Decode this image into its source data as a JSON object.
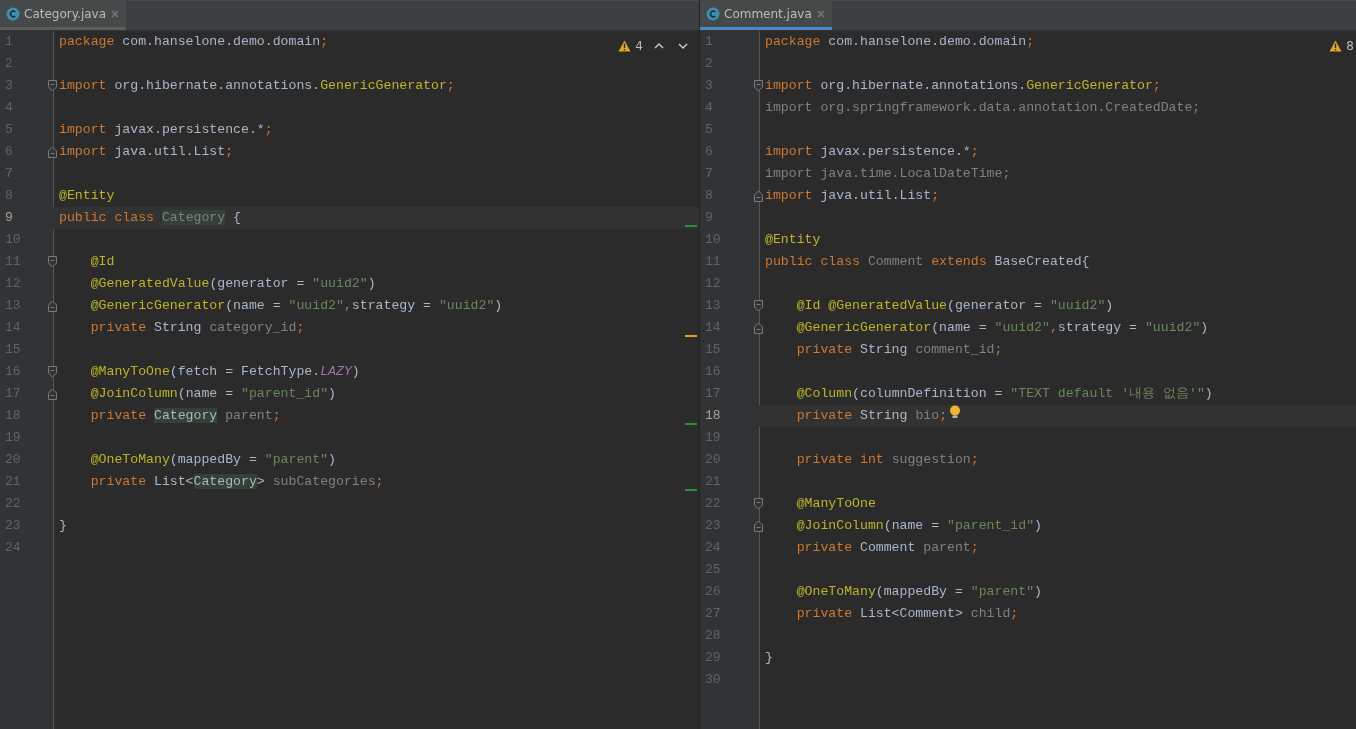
{
  "editors": [
    {
      "focused": false,
      "tab": {
        "label": "Category.java",
        "selected": true
      },
      "inspections": {
        "warnings": "4",
        "nav_arrows": true
      },
      "lines": [
        {
          "number": "1",
          "current": false,
          "tokens": [
            {
              "kind": "keyword",
              "text": "package "
            },
            {
              "kind": "plain",
              "text": "com.hanselone.demo.domain"
            },
            {
              "kind": "keyword",
              "text": ";"
            }
          ]
        },
        {
          "number": "2",
          "current": false
        },
        {
          "number": "3",
          "current": false,
          "fold": {
            "kind": "start"
          },
          "tokens": [
            {
              "kind": "keyword",
              "text": "import "
            },
            {
              "kind": "plain",
              "text": "org.hibernate.annotations."
            },
            {
              "kind": "annotation",
              "text": "GenericGenerator"
            },
            {
              "kind": "keyword",
              "text": ";"
            }
          ]
        },
        {
          "number": "4",
          "current": false
        },
        {
          "number": "5",
          "current": false,
          "tokens": [
            {
              "kind": "keyword",
              "text": "import "
            },
            {
              "kind": "plain",
              "text": "javax.persistence.*"
            },
            {
              "kind": "keyword",
              "text": ";"
            }
          ]
        },
        {
          "number": "6",
          "current": false,
          "fold": {
            "kind": "end"
          },
          "tokens": [
            {
              "kind": "keyword",
              "text": "import "
            },
            {
              "kind": "plain",
              "text": "java.util.List"
            },
            {
              "kind": "keyword",
              "text": ";"
            }
          ]
        },
        {
          "number": "7",
          "current": false
        },
        {
          "number": "8",
          "current": false,
          "tokens": [
            {
              "kind": "annotation",
              "text": "@Entity"
            }
          ]
        },
        {
          "number": "9",
          "current": true,
          "tokens": [
            {
              "kind": "keyword",
              "text": "public class "
            },
            {
              "kind": "declaration",
              "text": "Category"
            },
            {
              "kind": "plain",
              "text": " {"
            }
          ]
        },
        {
          "number": "10",
          "current": false,
          "stripe": {
            "color": "#2f8a3a"
          }
        },
        {
          "number": "11",
          "current": false,
          "fold": {
            "kind": "start"
          },
          "tokens": [
            {
              "kind": "annotation",
              "text": "    @Id"
            }
          ]
        },
        {
          "number": "12",
          "current": false,
          "tokens": [
            {
              "kind": "annotation",
              "text": "    @GeneratedValue"
            },
            {
              "kind": "plain",
              "text": "(generator = "
            },
            {
              "kind": "string",
              "text": "\"uuid2\""
            },
            {
              "kind": "plain",
              "text": ")"
            }
          ]
        },
        {
          "number": "13",
          "current": false,
          "fold": {
            "kind": "end"
          },
          "tokens": [
            {
              "kind": "annotation",
              "text": "    @GenericGenerator"
            },
            {
              "kind": "plain",
              "text": "(name = "
            },
            {
              "kind": "string",
              "text": "\"uuid2\""
            },
            {
              "kind": "keyword",
              "text": ","
            },
            {
              "kind": "plain",
              "text": "strategy = "
            },
            {
              "kind": "string",
              "text": "\"uuid2\""
            },
            {
              "kind": "plain",
              "text": ")"
            }
          ]
        },
        {
          "number": "14",
          "current": false,
          "tokens": [
            {
              "kind": "keyword",
              "text": "    private "
            },
            {
              "kind": "plain",
              "text": "String "
            },
            {
              "kind": "unused",
              "text": "category_id"
            },
            {
              "kind": "keyword",
              "text": ";"
            }
          ]
        },
        {
          "number": "15",
          "current": false,
          "stripe": {
            "color": "#d9a31c"
          }
        },
        {
          "number": "16",
          "current": false,
          "fold": {
            "kind": "start"
          },
          "tokens": [
            {
              "kind": "annotation",
              "text": "    @ManyToOne"
            },
            {
              "kind": "plain",
              "text": "(fetch = FetchType."
            },
            {
              "kind": "constant",
              "text": "LAZY"
            },
            {
              "kind": "plain",
              "text": ")"
            }
          ]
        },
        {
          "number": "17",
          "current": false,
          "fold": {
            "kind": "end"
          },
          "tokens": [
            {
              "kind": "annotation",
              "text": "    @JoinColumn"
            },
            {
              "kind": "plain",
              "text": "(name = "
            },
            {
              "kind": "string",
              "text": "\"parent_id\""
            },
            {
              "kind": "plain",
              "text": ")"
            }
          ]
        },
        {
          "number": "18",
          "current": false,
          "tokens": [
            {
              "kind": "keyword",
              "text": "    private "
            },
            {
              "kind": "usage",
              "text": "Category"
            },
            {
              "kind": "unused",
              "text": " parent"
            },
            {
              "kind": "keyword",
              "text": ";"
            }
          ]
        },
        {
          "number": "19",
          "current": false,
          "stripe": {
            "color": "#2f8a3a"
          }
        },
        {
          "number": "20",
          "current": false,
          "tokens": [
            {
              "kind": "annotation",
              "text": "    @OneToMany"
            },
            {
              "kind": "plain",
              "text": "(mappedBy = "
            },
            {
              "kind": "string",
              "text": "\"parent\""
            },
            {
              "kind": "plain",
              "text": ")"
            }
          ]
        },
        {
          "number": "21",
          "current": false,
          "tokens": [
            {
              "kind": "keyword",
              "text": "    private "
            },
            {
              "kind": "plain",
              "text": "List<"
            },
            {
              "kind": "usage",
              "text": "Category"
            },
            {
              "kind": "plain",
              "text": "> "
            },
            {
              "kind": "unused",
              "text": "subCategories"
            },
            {
              "kind": "keyword",
              "text": ";"
            }
          ]
        },
        {
          "number": "22",
          "current": false,
          "stripe": {
            "color": "#2f8a3a"
          }
        },
        {
          "number": "23",
          "current": false,
          "tokens": [
            {
              "kind": "plain",
              "text": "}"
            }
          ]
        },
        {
          "number": "24",
          "current": false
        }
      ]
    },
    {
      "focused": true,
      "tab": {
        "label": "Comment.java",
        "selected": true
      },
      "inspections": {
        "warnings": "8",
        "nav_arrows": false
      },
      "lines": [
        {
          "number": "1",
          "current": false,
          "tokens": [
            {
              "kind": "keyword",
              "text": "package "
            },
            {
              "kind": "plain",
              "text": "com.hanselone.demo.domain"
            },
            {
              "kind": "keyword",
              "text": ";"
            }
          ]
        },
        {
          "number": "2",
          "current": false
        },
        {
          "number": "3",
          "current": false,
          "fold": {
            "kind": "start"
          },
          "tokens": [
            {
              "kind": "keyword",
              "text": "import "
            },
            {
              "kind": "plain",
              "text": "org.hibernate.annotations."
            },
            {
              "kind": "annotation",
              "text": "GenericGenerator"
            },
            {
              "kind": "keyword",
              "text": ";"
            }
          ]
        },
        {
          "number": "4",
          "current": false,
          "tokens": [
            {
              "kind": "unused",
              "text": "import org.springframework.data.annotation.CreatedDate;"
            }
          ]
        },
        {
          "number": "5",
          "current": false
        },
        {
          "number": "6",
          "current": false,
          "tokens": [
            {
              "kind": "keyword",
              "text": "import "
            },
            {
              "kind": "plain",
              "text": "javax.persistence.*"
            },
            {
              "kind": "keyword",
              "text": ";"
            }
          ]
        },
        {
          "number": "7",
          "current": false,
          "tokens": [
            {
              "kind": "unused",
              "text": "import java.time.LocalDateTime;"
            }
          ]
        },
        {
          "number": "8",
          "current": false,
          "fold": {
            "kind": "end"
          },
          "tokens": [
            {
              "kind": "keyword",
              "text": "import "
            },
            {
              "kind": "plain",
              "text": "java.util.List"
            },
            {
              "kind": "keyword",
              "text": ";"
            }
          ]
        },
        {
          "number": "9",
          "current": false
        },
        {
          "number": "10",
          "current": false,
          "tokens": [
            {
              "kind": "annotation",
              "text": "@Entity"
            }
          ]
        },
        {
          "number": "11",
          "current": false,
          "tokens": [
            {
              "kind": "keyword",
              "text": "public class "
            },
            {
              "kind": "unused",
              "text": "Comment"
            },
            {
              "kind": "keyword",
              "text": " extends "
            },
            {
              "kind": "plain",
              "text": "BaseCreated{"
            }
          ]
        },
        {
          "number": "12",
          "current": false
        },
        {
          "number": "13",
          "current": false,
          "fold": {
            "kind": "start"
          },
          "tokens": [
            {
              "kind": "annotation",
              "text": "    @Id @GeneratedValue"
            },
            {
              "kind": "plain",
              "text": "(generator = "
            },
            {
              "kind": "string",
              "text": "\"uuid2\""
            },
            {
              "kind": "plain",
              "text": ")"
            }
          ]
        },
        {
          "number": "14",
          "current": false,
          "fold": {
            "kind": "end"
          },
          "tokens": [
            {
              "kind": "annotation",
              "text": "    @GenericGenerator"
            },
            {
              "kind": "plain",
              "text": "(name = "
            },
            {
              "kind": "string",
              "text": "\"uuid2\""
            },
            {
              "kind": "keyword",
              "text": ","
            },
            {
              "kind": "plain",
              "text": "strategy = "
            },
            {
              "kind": "string",
              "text": "\"uuid2\""
            },
            {
              "kind": "plain",
              "text": ")"
            }
          ]
        },
        {
          "number": "15",
          "current": false,
          "tokens": [
            {
              "kind": "keyword",
              "text": "    private "
            },
            {
              "kind": "plain",
              "text": "String "
            },
            {
              "kind": "unused",
              "text": "comment_id"
            },
            {
              "kind": "keyword",
              "text": ";"
            }
          ]
        },
        {
          "number": "16",
          "current": false
        },
        {
          "number": "17",
          "current": false,
          "tokens": [
            {
              "kind": "annotation",
              "text": "    @Column"
            },
            {
              "kind": "plain",
              "text": "(columnDefinition = "
            },
            {
              "kind": "string",
              "text": "\"TEXT default '내용 없음'\""
            },
            {
              "kind": "plain",
              "text": ")"
            }
          ]
        },
        {
          "number": "18",
          "current": true,
          "tokens": [
            {
              "kind": "keyword",
              "text": "    private "
            },
            {
              "kind": "plain",
              "text": "String "
            },
            {
              "kind": "unused",
              "text": "bio"
            },
            {
              "kind": "keyword",
              "text": ";"
            },
            {
              "kind": "bulb"
            }
          ]
        },
        {
          "number": "19",
          "current": false
        },
        {
          "number": "20",
          "current": false,
          "tokens": [
            {
              "kind": "keyword",
              "text": "    private int "
            },
            {
              "kind": "unused",
              "text": "suggestion"
            },
            {
              "kind": "keyword",
              "text": ";"
            }
          ]
        },
        {
          "number": "21",
          "current": false
        },
        {
          "number": "22",
          "current": false,
          "fold": {
            "kind": "start"
          },
          "tokens": [
            {
              "kind": "annotation",
              "text": "    @ManyToOne"
            }
          ]
        },
        {
          "number": "23",
          "current": false,
          "fold": {
            "kind": "end"
          },
          "tokens": [
            {
              "kind": "annotation",
              "text": "    @JoinColumn"
            },
            {
              "kind": "plain",
              "text": "(name = "
            },
            {
              "kind": "string",
              "text": "\"parent_id\""
            },
            {
              "kind": "plain",
              "text": ")"
            }
          ]
        },
        {
          "number": "24",
          "current": false,
          "tokens": [
            {
              "kind": "keyword",
              "text": "    private "
            },
            {
              "kind": "plain",
              "text": "Comment "
            },
            {
              "kind": "unused",
              "text": "parent"
            },
            {
              "kind": "keyword",
              "text": ";"
            }
          ]
        },
        {
          "number": "25",
          "current": false
        },
        {
          "number": "26",
          "current": false,
          "tokens": [
            {
              "kind": "annotation",
              "text": "    @OneToMany"
            },
            {
              "kind": "plain",
              "text": "(mappedBy = "
            },
            {
              "kind": "string",
              "text": "\"parent\""
            },
            {
              "kind": "plain",
              "text": ")"
            }
          ]
        },
        {
          "number": "27",
          "current": false,
          "tokens": [
            {
              "kind": "keyword",
              "text": "    private "
            },
            {
              "kind": "plain",
              "text": "List<Comment> "
            },
            {
              "kind": "unused",
              "text": "child"
            },
            {
              "kind": "keyword",
              "text": ";"
            }
          ]
        },
        {
          "number": "28",
          "current": false
        },
        {
          "number": "29",
          "current": false,
          "tokens": [
            {
              "kind": "plain",
              "text": "}"
            }
          ]
        },
        {
          "number": "30",
          "current": false
        }
      ]
    }
  ]
}
